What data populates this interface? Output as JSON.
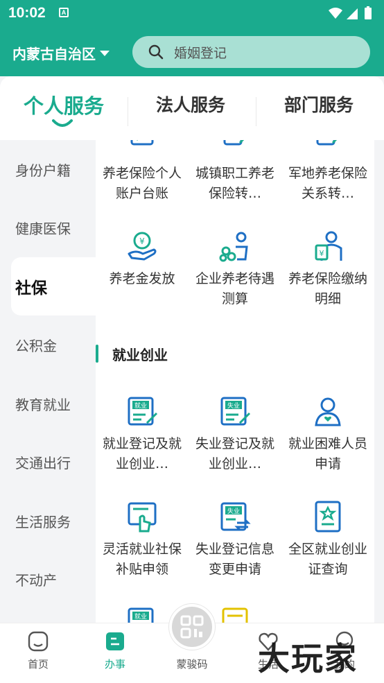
{
  "status_bar": {
    "time": "10:02",
    "notification_glyph": "A"
  },
  "header": {
    "region": "内蒙古自治区",
    "search_placeholder": "婚姻登记"
  },
  "tabs": [
    {
      "label": "个人服务",
      "active": true
    },
    {
      "label": "法人服务",
      "active": false
    },
    {
      "label": "部门服务",
      "active": false
    }
  ],
  "sidebar": [
    {
      "label": "身份户籍"
    },
    {
      "label": "健康医保"
    },
    {
      "label": "社保",
      "active": true
    },
    {
      "label": "公积金"
    },
    {
      "label": "教育就业"
    },
    {
      "label": "交通出行"
    },
    {
      "label": "生活服务"
    },
    {
      "label": "不动产"
    }
  ],
  "services_top": [
    {
      "label": "养老保险个人账户台账",
      "icon": "pension-ledger-icon"
    },
    {
      "label": "城镇职工养老保险转…",
      "icon": "pension-transfer-icon"
    },
    {
      "label": "军地养老保险关系转…",
      "icon": "military-pension-icon"
    },
    {
      "label": "养老金发放",
      "icon": "pension-payout-icon"
    },
    {
      "label": "企业养老待遇测算",
      "icon": "pension-calc-icon"
    },
    {
      "label": "养老保险缴纳明细",
      "icon": "pension-detail-icon"
    }
  ],
  "section": {
    "title": "就业创业"
  },
  "services_employment": [
    {
      "label": "就业登记及就业创业…",
      "icon": "employment-register-icon",
      "tag": "就业"
    },
    {
      "label": "失业登记及就业创业…",
      "icon": "unemployment-register-icon",
      "tag": "失业"
    },
    {
      "label": "就业困难人员申请",
      "icon": "hardship-person-icon"
    },
    {
      "label": "灵活就业社保补贴申领",
      "icon": "flexible-subsidy-icon"
    },
    {
      "label": "失业登记信息变更申请",
      "icon": "unemployment-change-icon",
      "tag": "失业"
    },
    {
      "label": "全区就业创业证查询",
      "icon": "certificate-query-icon"
    }
  ],
  "peek_tag": "就业",
  "bottom_nav": [
    {
      "label": "首页",
      "icon": "home-icon"
    },
    {
      "label": "办事",
      "icon": "tasks-icon",
      "active": true
    },
    {
      "label": "蒙骏码",
      "icon": "qr-code-icon"
    },
    {
      "label": "生活",
      "icon": "heart-icon"
    },
    {
      "label": "我的",
      "icon": "user-icon"
    }
  ],
  "watermark": "大玩家",
  "colors": {
    "primary": "#1aab8e",
    "icon_blue": "#1e6fc4",
    "icon_green": "#1aab8e",
    "search_bg": "#a9e0d4"
  }
}
